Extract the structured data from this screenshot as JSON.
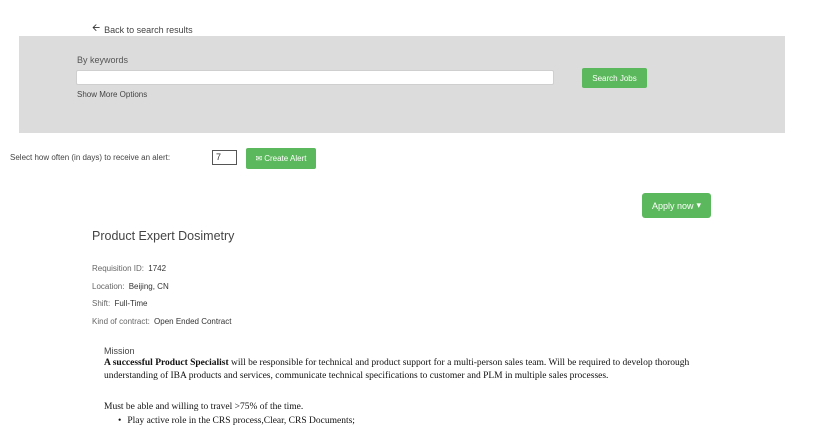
{
  "nav": {
    "back_label": "Back to search results",
    "back_icon": "left-arrow-icon"
  },
  "search": {
    "keywords_label": "By keywords",
    "keywords_value": "",
    "search_button": "Search Jobs",
    "more_options": "Show More Options"
  },
  "alert": {
    "label": "Select how often (in days) to receive an alert:",
    "days_value": "7",
    "button_label": "Create Alert",
    "button_icon": "envelope-icon"
  },
  "apply": {
    "label": "Apply now",
    "caret_icon": "caret-down-icon"
  },
  "job": {
    "title": "Product Expert Dosimetry",
    "requisition_label": "Requisition ID:",
    "requisition_value": "1742",
    "location_label": "Location:",
    "location_value": "Beijing, CN",
    "shift_label": "Shift:",
    "shift_value": "Full-Time",
    "contract_label": "Kind of contract:",
    "contract_value": "Open Ended Contract"
  },
  "description": {
    "mission_heading": "Mission",
    "intro_bold": "A successful Product Specialist",
    "intro_rest": " will be responsible for technical and product support for a multi-person sales team. Will be required to develop thorough understanding of IBA products and services, communicate technical specifications to customer and PLM in multiple sales processes.",
    "travel": "Must be able and willing to travel >75% of the time.",
    "bullets": [
      "Play active role in the CRS process,Clear, CRS Documents;"
    ]
  },
  "colors": {
    "accent_green": "#5cb85c",
    "panel_gray": "#dcdcdc"
  }
}
